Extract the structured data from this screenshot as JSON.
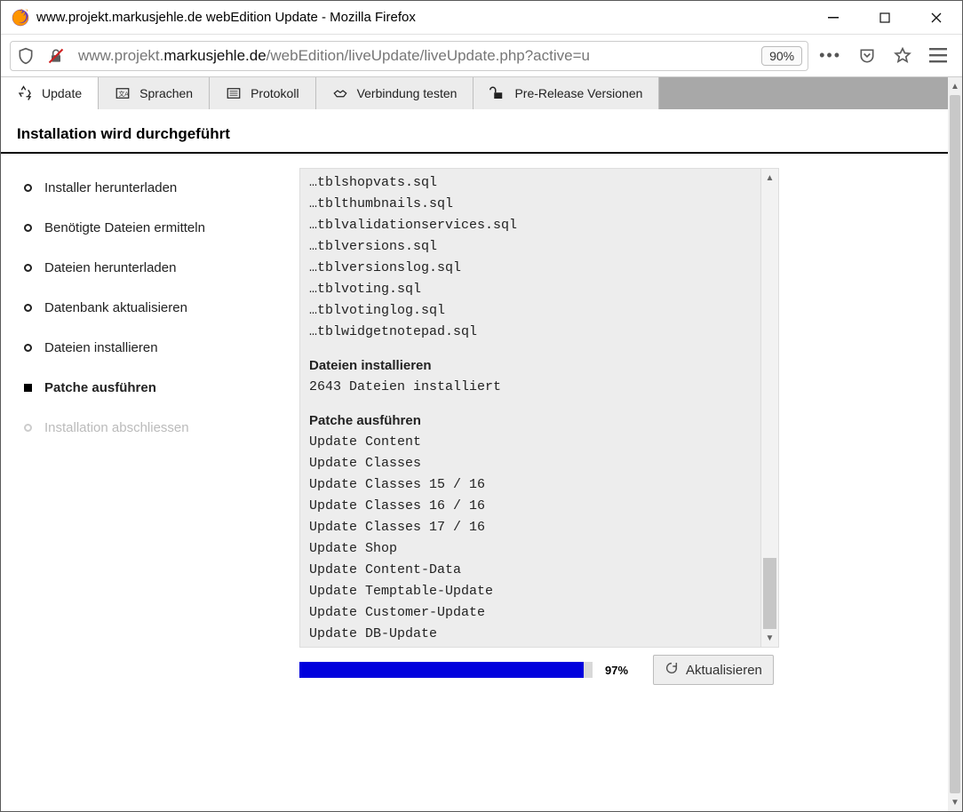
{
  "window": {
    "title": "www.projekt.markusjehle.de webEdition Update - Mozilla Firefox"
  },
  "toolbar": {
    "url_prefix": "www.projekt.",
    "url_bold": "markusjehle.de",
    "url_suffix": "/webEdition/liveUpdate/liveUpdate.php?active=u",
    "zoom": "90%"
  },
  "tabs": [
    {
      "label": "Update",
      "icon": "recycle",
      "active": true
    },
    {
      "label": "Sprachen",
      "icon": "language"
    },
    {
      "label": "Protokoll",
      "icon": "list"
    },
    {
      "label": "Verbindung testen",
      "icon": "handshake"
    },
    {
      "label": "Pre-Release Versionen",
      "icon": "lock-open"
    }
  ],
  "heading": "Installation wird durchgeführt",
  "steps": [
    {
      "label": "Installer herunterladen",
      "state": "done"
    },
    {
      "label": "Benötigte Dateien ermitteln",
      "state": "done"
    },
    {
      "label": "Dateien herunterladen",
      "state": "done"
    },
    {
      "label": "Datenbank aktualisieren",
      "state": "done"
    },
    {
      "label": "Dateien installieren",
      "state": "done"
    },
    {
      "label": "Patche ausführen",
      "state": "current"
    },
    {
      "label": "Installation abschliessen",
      "state": "pending"
    }
  ],
  "log": {
    "sql_files": [
      "…tblshopvats.sql",
      "…tblthumbnails.sql",
      "…tblvalidationservices.sql",
      "…tblversions.sql",
      "…tblversionslog.sql",
      "…tblvoting.sql",
      "…tblvotinglog.sql",
      "…tblwidgetnotepad.sql"
    ],
    "install_title": "Dateien installieren",
    "install_result": "2643 Dateien installiert",
    "patch_title": "Patche ausführen",
    "patch_lines": [
      "Update Content",
      "Update Classes",
      "Update Classes 15 / 16",
      "Update Classes 16 / 16",
      "Update Classes 17 / 16",
      "Update Shop",
      "Update Content-Data",
      "Update Temptable-Update",
      "Update Customer-Update",
      "Update DB-Update"
    ]
  },
  "progress": {
    "percent_label": "97%",
    "percent_value": 97
  },
  "refresh_label": "Aktualisieren"
}
